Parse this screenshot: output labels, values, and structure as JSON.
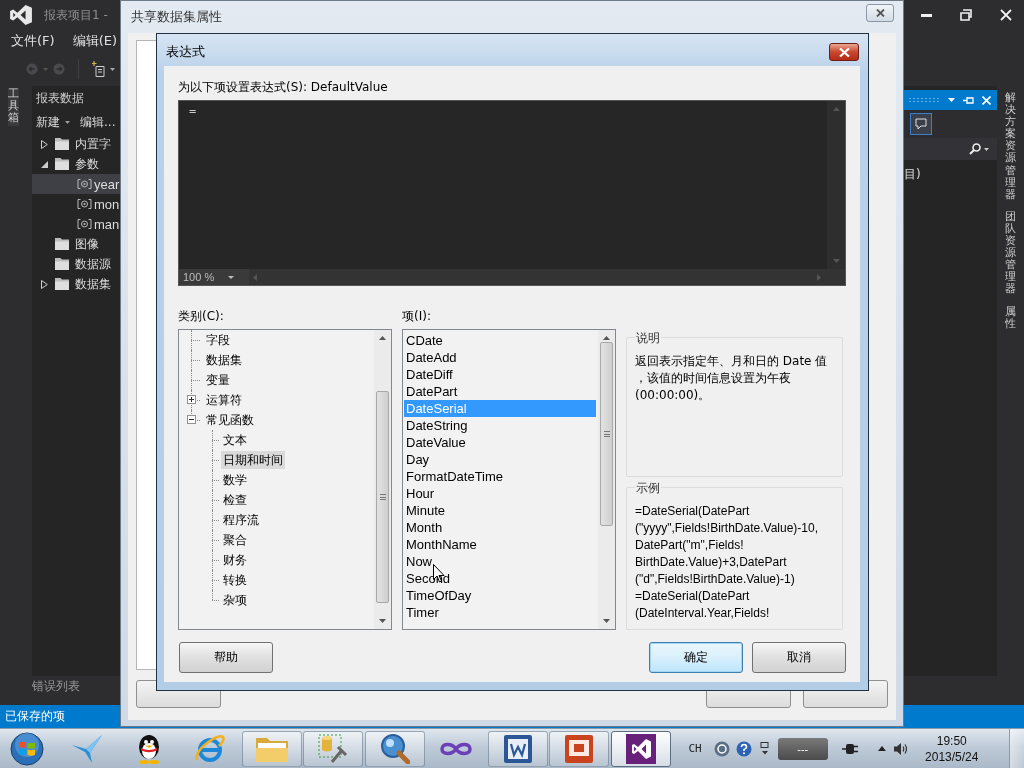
{
  "ide": {
    "title": "报表项目1 -",
    "menu": [
      "文件(F)",
      "编辑(E)"
    ],
    "toolbox_tab": "工具箱",
    "report_data": {
      "title": "报表数据",
      "new_menu": "新建",
      "edit_link": "编辑...",
      "tree": [
        {
          "label": "内置字",
          "kind": "folder",
          "expanded": false,
          "selected": false
        },
        {
          "label": "参数",
          "kind": "folder",
          "expanded": true,
          "selected": false,
          "children": [
            {
              "label": "year",
              "kind": "parameter",
              "selected": true
            },
            {
              "label": "mon",
              "kind": "parameter",
              "selected": false
            },
            {
              "label": "man",
              "kind": "parameter",
              "selected": false
            }
          ]
        },
        {
          "label": "图像",
          "kind": "folder",
          "selected": false
        },
        {
          "label": "数据源",
          "kind": "folder",
          "selected": false
        },
        {
          "label": "数据集",
          "kind": "folder",
          "expanded": false,
          "selected": false
        }
      ]
    },
    "error_list_tab": "错误列表",
    "status_bar": "已保存的项",
    "solution_explorer": {
      "visible_text": "目)"
    },
    "side_tabs": [
      "解决方案资源管理器",
      "团队资源管理器",
      "属性"
    ]
  },
  "dataset_dialog": {
    "title": "共享数据集属性"
  },
  "expression_dialog": {
    "title": "表达式",
    "prompt": "为以下项设置表达式(S): DefaultValue",
    "expression": "=",
    "zoom": "100 %",
    "category_label": "类别(C):",
    "categories": [
      {
        "label": "字段",
        "kind": "leaf",
        "selected": false
      },
      {
        "label": "数据集",
        "kind": "leaf",
        "selected": false
      },
      {
        "label": "变量",
        "kind": "leaf",
        "selected": false
      },
      {
        "label": "运算符",
        "kind": "branch",
        "expanded": false,
        "selected": false
      },
      {
        "label": "常见函数",
        "kind": "branch",
        "expanded": true,
        "selected": false,
        "children": [
          {
            "label": "文本",
            "selected": false
          },
          {
            "label": "日期和时间",
            "selected": true
          },
          {
            "label": "数学",
            "selected": false
          },
          {
            "label": "检查",
            "selected": false
          },
          {
            "label": "程序流",
            "selected": false
          },
          {
            "label": "聚合",
            "selected": false
          },
          {
            "label": "财务",
            "selected": false
          },
          {
            "label": "转换",
            "selected": false
          },
          {
            "label": "杂项",
            "selected": false
          }
        ]
      }
    ],
    "item_label": "项(I):",
    "items": [
      {
        "label": "CDate",
        "selected": false
      },
      {
        "label": "DateAdd",
        "selected": false
      },
      {
        "label": "DateDiff",
        "selected": false
      },
      {
        "label": "DatePart",
        "selected": false
      },
      {
        "label": "DateSerial",
        "selected": true
      },
      {
        "label": "DateString",
        "selected": false
      },
      {
        "label": "DateValue",
        "selected": false
      },
      {
        "label": "Day",
        "selected": false
      },
      {
        "label": "FormatDateTime",
        "selected": false
      },
      {
        "label": "Hour",
        "selected": false
      },
      {
        "label": "Minute",
        "selected": false
      },
      {
        "label": "Month",
        "selected": false
      },
      {
        "label": "MonthName",
        "selected": false
      },
      {
        "label": "Now",
        "selected": false
      },
      {
        "label": "Second",
        "selected": false
      },
      {
        "label": "TimeOfDay",
        "selected": false
      },
      {
        "label": "Timer",
        "selected": false
      }
    ],
    "description": {
      "title": "说明",
      "lines": [
        "返回表示指定年、月和日的 Date 值",
        "，该值的时间信息设置为午夜",
        "(00:00:00)。"
      ]
    },
    "example": {
      "title": "示例",
      "lines": [
        "=DateSerial(DatePart",
        "(\"yyyy\",Fields!BirthDate.Value)-10,",
        "DatePart(\"m\",Fields!",
        "BirthDate.Value)+3,DatePart",
        "(\"d\",Fields!BirthDate.Value)-1)",
        "=DateSerial(DatePart",
        "(DateInterval.Year,Fields!"
      ]
    },
    "buttons": [
      {
        "label": "帮助",
        "kind": "help"
      },
      {
        "label": "确定",
        "kind": "default"
      },
      {
        "label": "取消",
        "kind": "cancel"
      }
    ]
  },
  "taskbar": {
    "buttons": [
      {
        "running": false,
        "selected": false
      },
      {
        "running": false,
        "selected": false
      },
      {
        "running": false,
        "selected": false
      },
      {
        "running": true,
        "selected": false
      },
      {
        "running": true,
        "selected": false
      },
      {
        "running": true,
        "selected": false
      },
      {
        "running": false,
        "selected": false
      },
      {
        "running": true,
        "selected": false
      },
      {
        "running": true,
        "selected": false
      },
      {
        "running": true,
        "selected": true
      }
    ],
    "language": "CH",
    "indicator": "---",
    "clock": {
      "time": "19:50",
      "date": "2013/5/24"
    }
  }
}
